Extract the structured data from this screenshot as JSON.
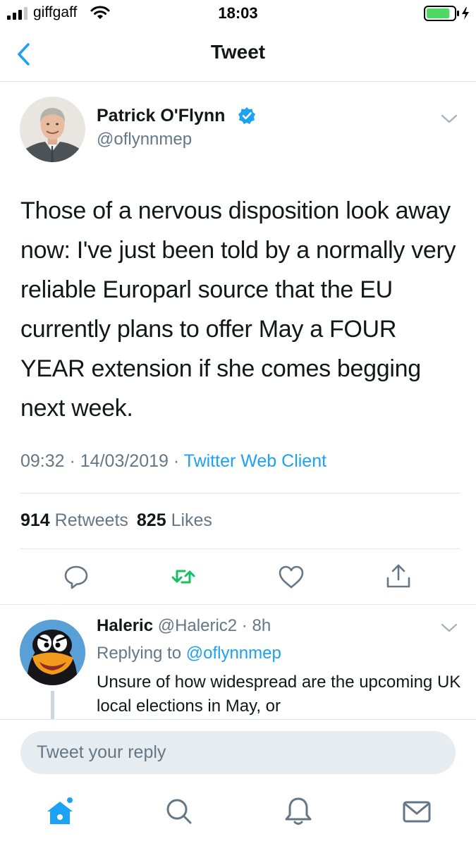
{
  "status_bar": {
    "carrier": "giffgaff",
    "time": "18:03",
    "signal_bars": 4,
    "battery_level": 0.85,
    "charging": true
  },
  "header": {
    "title": "Tweet",
    "back_icon": "chevron-left-icon"
  },
  "tweet": {
    "author_name": "Patrick O'Flynn",
    "author_handle": "@oflynnmep",
    "verified": true,
    "text": "Those of a nervous disposition look away now: I've just been told by a normally very reliable Europarl source that the EU currently plans to offer May a FOUR YEAR extension if she comes begging next week.",
    "time": "09:32",
    "date": "14/03/2019",
    "separator": " · ",
    "client": "Twitter Web Client",
    "retweet_count": "914",
    "retweets_label": "Retweets",
    "like_count": "825",
    "likes_label": "Likes",
    "actions": [
      "reply-icon",
      "retweet-icon",
      "like-icon",
      "share-icon"
    ]
  },
  "reply": {
    "name": "Haleric",
    "handle": "@Haleric2",
    "separator": " · ",
    "age": "8h",
    "replying_to_label": "Replying to",
    "replying_to_handle": "@oflynnmep",
    "text": "Unsure of how widespread are the upcoming UK local elections in May, or"
  },
  "compose": {
    "placeholder": "Tweet your reply"
  },
  "tab_bar": {
    "items": [
      "home-icon",
      "search-icon",
      "notifications-icon",
      "messages-icon"
    ],
    "active": "home-icon"
  },
  "colors": {
    "accent": "#1da1f2",
    "retweet_green": "#17bf63",
    "text_primary": "#14171a",
    "text_secondary": "#657786",
    "battery_green": "#4cd964"
  }
}
